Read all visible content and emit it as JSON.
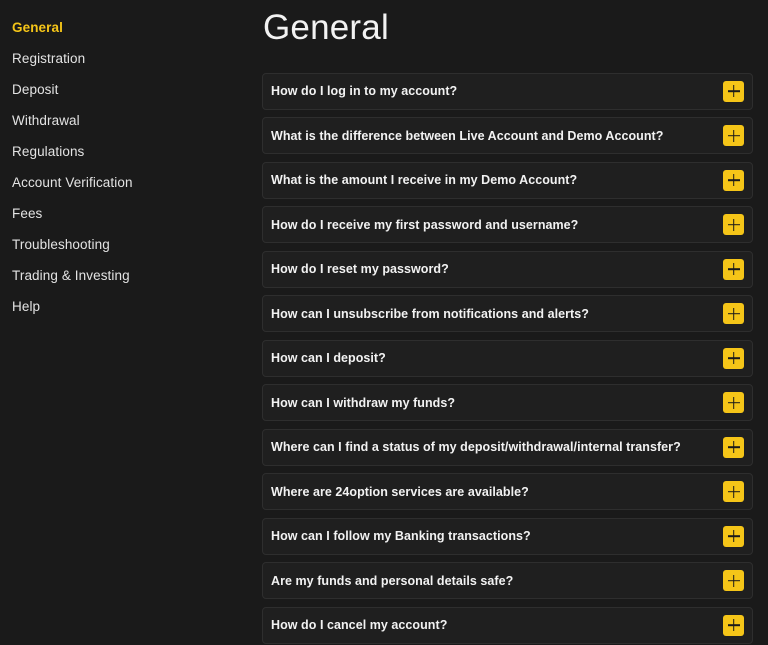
{
  "theme": {
    "background": "#1a1a1a",
    "row_background": "#1f1f1f",
    "row_border": "#2e2e2e",
    "accent": "#f5c518",
    "text": "#f2f2f2",
    "sidebar_text": "#e3e3e3"
  },
  "sidebar": {
    "items": [
      {
        "label": "General",
        "active": true
      },
      {
        "label": "Registration",
        "active": false
      },
      {
        "label": "Deposit",
        "active": false
      },
      {
        "label": "Withdrawal",
        "active": false
      },
      {
        "label": "Regulations",
        "active": false
      },
      {
        "label": "Account Verification",
        "active": false
      },
      {
        "label": "Fees",
        "active": false
      },
      {
        "label": "Troubleshooting",
        "active": false
      },
      {
        "label": "Trading & Investing",
        "active": false
      },
      {
        "label": "Help",
        "active": false
      }
    ]
  },
  "main": {
    "title": "General",
    "toggle_icon": "plus-icon",
    "faqs": [
      {
        "question": "How do I log in to my account?"
      },
      {
        "question": "What is the difference between Live Account and Demo Account?"
      },
      {
        "question": "What is the amount I receive in my Demo Account?"
      },
      {
        "question": "How do I receive my first password and username?"
      },
      {
        "question": "How do I reset my password?"
      },
      {
        "question": "How can I unsubscribe from notifications and alerts?"
      },
      {
        "question": "How can I deposit?"
      },
      {
        "question": "How can I withdraw my funds?"
      },
      {
        "question": "Where can I find a status of my deposit/withdrawal/internal transfer?"
      },
      {
        "question": "Where are 24option services are available?"
      },
      {
        "question": "How can I follow my Banking transactions?"
      },
      {
        "question": "Are my funds and personal details safe?"
      },
      {
        "question": "How do I cancel my account?"
      }
    ]
  }
}
